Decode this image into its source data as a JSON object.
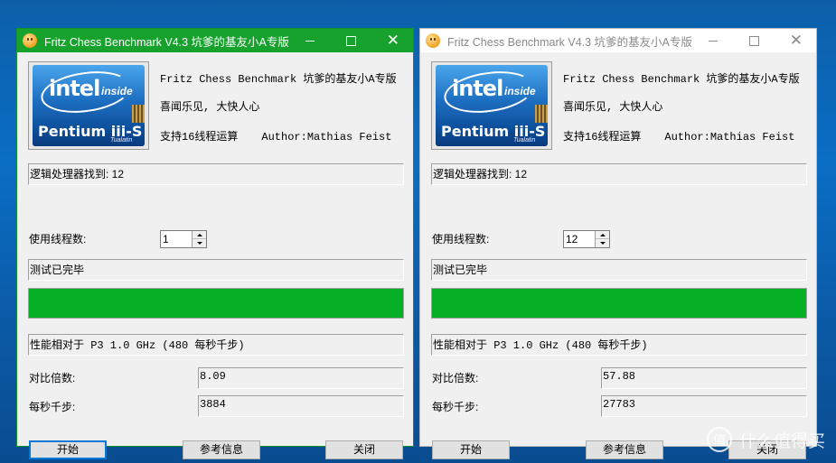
{
  "windows": [
    {
      "title": "Fritz Chess Benchmark V4.3  坑爹的基友小A专版",
      "logo_text": {
        "intel": "intel",
        "inside": "inside",
        "brand": "Pentium iii-S",
        "sub": "Tualatin"
      },
      "info_line1": "Fritz Chess Benchmark 坑爹的基友小A专版",
      "info_line2": "喜闻乐见, 大快人心",
      "info_line3": "支持16线程运算",
      "author": "Author:Mathias Feist",
      "cpu_found": "逻辑处理器找到: 12",
      "threads_label": "使用线程数:",
      "threads_value": "1",
      "status": "测试已完毕",
      "progress": 1.0,
      "perf_label": "性能相对于 P3 1.0 GHz (480 每秒千步)",
      "ratio_label": "对比倍数:",
      "ratio_value": "8.09",
      "kns_label": "每秒千步:",
      "kns_value": "3884",
      "buttons": {
        "start": "开始",
        "info": "参考信息",
        "close": "关闭"
      }
    },
    {
      "title": "Fritz Chess Benchmark V4.3  坑爹的基友小A专版",
      "logo_text": {
        "intel": "intel",
        "inside": "inside",
        "brand": "Pentium iii-S",
        "sub": "Tualatin"
      },
      "info_line1": "Fritz Chess Benchmark 坑爹的基友小A专版",
      "info_line2": "喜闻乐见, 大快人心",
      "info_line3": "支持16线程运算",
      "author": "Author:Mathias Feist",
      "cpu_found": "逻辑处理器找到: 12",
      "threads_label": "使用线程数:",
      "threads_value": "12",
      "status": "测试已完毕",
      "progress": 1.0,
      "perf_label": "性能相对于 P3 1.0 GHz (480 每秒千步)",
      "ratio_label": "对比倍数:",
      "ratio_value": "57.88",
      "kns_label": "每秒千步:",
      "kns_value": "27783",
      "buttons": {
        "start": "开始",
        "info": "参考信息",
        "close": "关闭"
      }
    }
  ],
  "watermark": {
    "icon": "值",
    "text": "什么值得买"
  },
  "colors": {
    "active_title": "#17a22d",
    "progress": "#06b025",
    "desktop": "#0a6ec4"
  }
}
